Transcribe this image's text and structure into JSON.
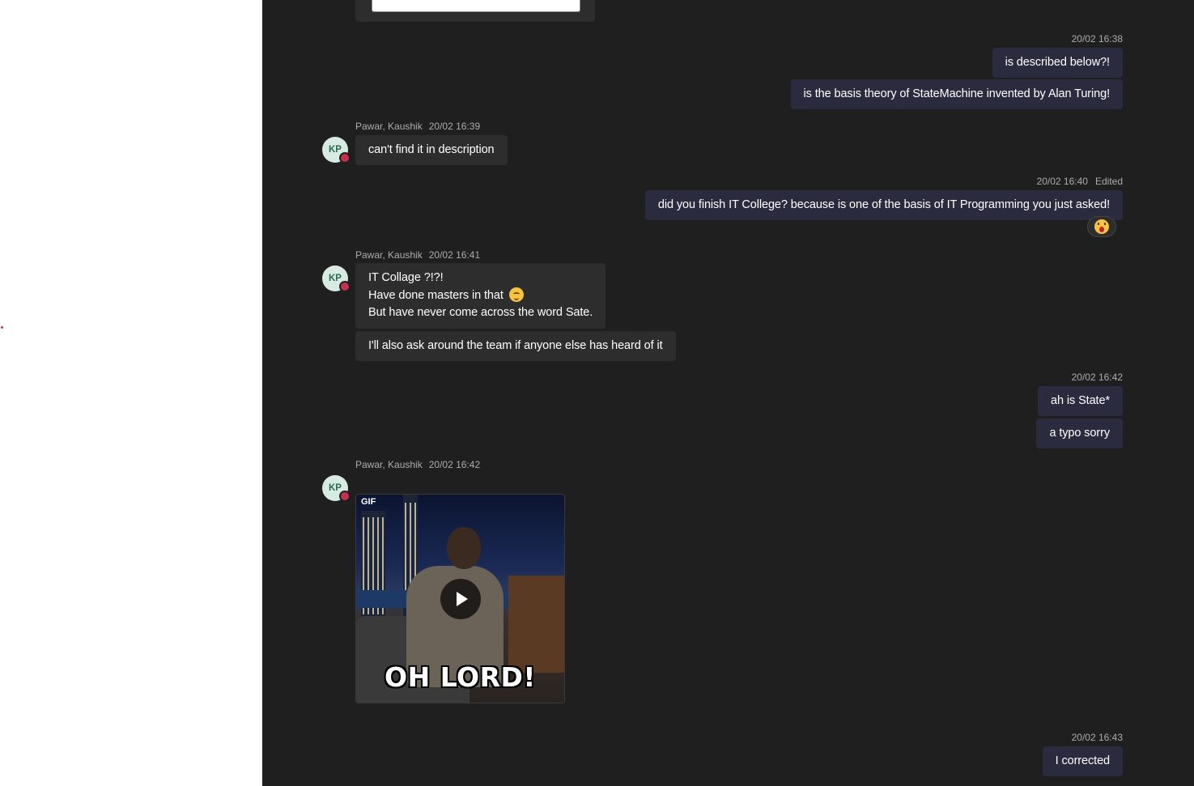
{
  "messages": [
    {
      "time": "20/02 16:38",
      "lines": [
        "is described below?!",
        "is the basis theory of StateMachine invented by Alan Turing!"
      ]
    },
    {
      "sender": "Pawar, Kaushik",
      "initials": "KP",
      "time": "20/02 16:39",
      "text": "can't find it in description"
    },
    {
      "time": "20/02 16:40",
      "edited": "Edited",
      "text": "did you finish IT College? because is one of the basis of IT Programming you just asked!",
      "reaction": "surprised-face-emoji"
    },
    {
      "sender": "Pawar, Kaushik",
      "initials": "KP",
      "time": "20/02 16:41",
      "lines": [
        "IT Collage ?!?!",
        "Have done masters in that",
        "But have never come across the word Sate."
      ],
      "emoji": "grimacing-face-emoji",
      "text2": "I'll also ask around the team if anyone else has heard of it"
    },
    {
      "time": "20/02 16:42",
      "lines": [
        "ah is State*",
        "a typo sorry"
      ]
    },
    {
      "sender": "Pawar, Kaushik",
      "initials": "KP",
      "time": "20/02 16:42",
      "gif": {
        "source_label": "GIF",
        "caption": "OH LORD!"
      }
    },
    {
      "time": "20/02 16:43",
      "text": "I corrected"
    }
  ],
  "colors": {
    "chat_bg": "#1f1f1f",
    "my_bubble": "#2b2b40",
    "their_bubble": "#2d2d2d",
    "presence_busy": "#c4314b",
    "avatar_bg": "#d7ebe2",
    "avatar_text": "#2e6b54"
  }
}
